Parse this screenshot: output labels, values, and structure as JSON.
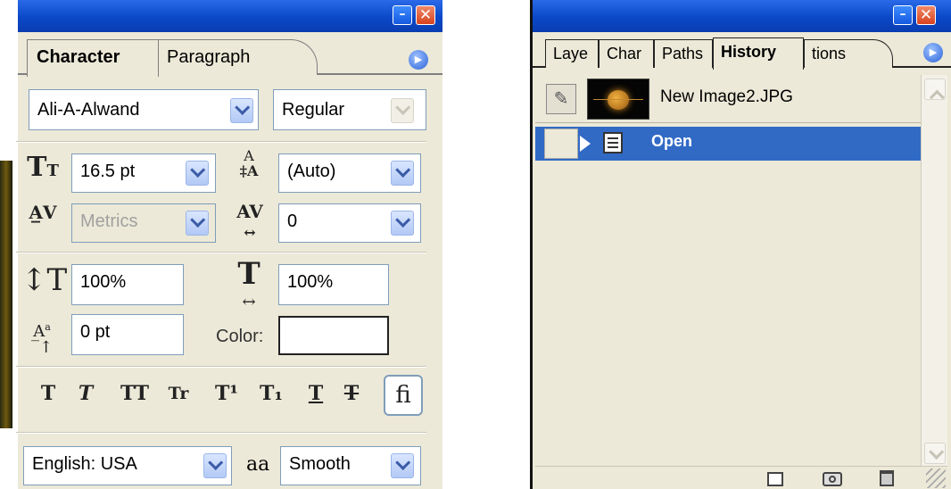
{
  "character_panel": {
    "tabs": [
      "Character",
      "Paragraph"
    ],
    "font_family": "Ali-A-Alwand",
    "font_style": "Regular",
    "font_size": "16.5 pt",
    "leading": "(Auto)",
    "kerning": "Metrics",
    "tracking": "0",
    "vertical_scale": "100%",
    "horizontal_scale": "100%",
    "baseline_shift": "0 pt",
    "color_label": "Color:",
    "color_value": "#ffffff",
    "style_buttons": [
      "T",
      "T",
      "TT",
      "Tr",
      "T¹",
      "T₁",
      "T",
      "T",
      "ﬁ"
    ],
    "language": "English: USA",
    "antialias_icon": "aa",
    "antialias": "Smooth"
  },
  "history_panel": {
    "tabs": [
      "Laye",
      "Char",
      "Paths",
      "History",
      "tions"
    ],
    "snapshot_name": "New Image2.JPG",
    "states": [
      {
        "label": "Open"
      }
    ]
  },
  "colors": {
    "title_bar": "#0a48c8",
    "panel_bg": "#ece9d8",
    "selection": "#316ac5"
  }
}
